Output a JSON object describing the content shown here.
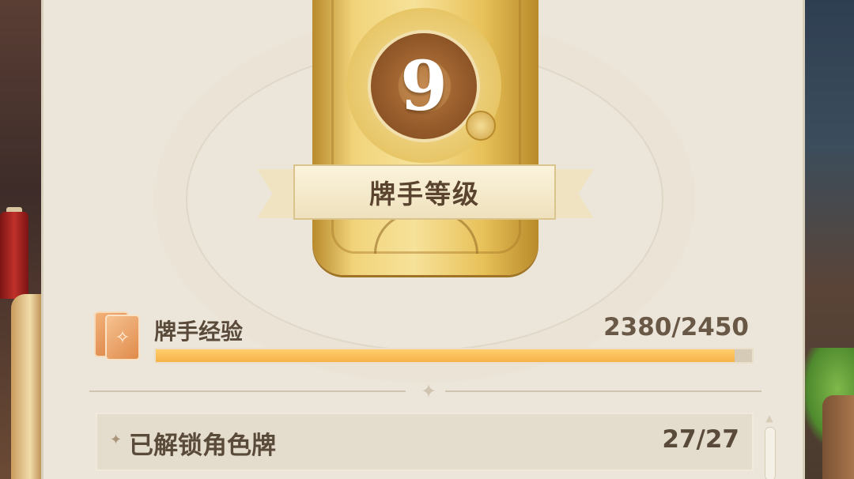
{
  "card_level": {
    "value": "9",
    "title": "牌手等级"
  },
  "experience": {
    "label": "牌手经验",
    "value": "2380/2450",
    "progress_fraction": 0.9714
  },
  "unlocked_character_cards": {
    "label": "已解锁角色牌",
    "value": "27/27"
  },
  "colors": {
    "panel_background": "#ece6da",
    "progress_fill": "#f6b24a",
    "text_primary": "#5a4a3a",
    "badge_gold": "#f1d37a"
  },
  "icons": {
    "experience": "card-deck-icon",
    "divider": "diamond-star-icon",
    "bullet": "sparkle-bullet-icon"
  }
}
